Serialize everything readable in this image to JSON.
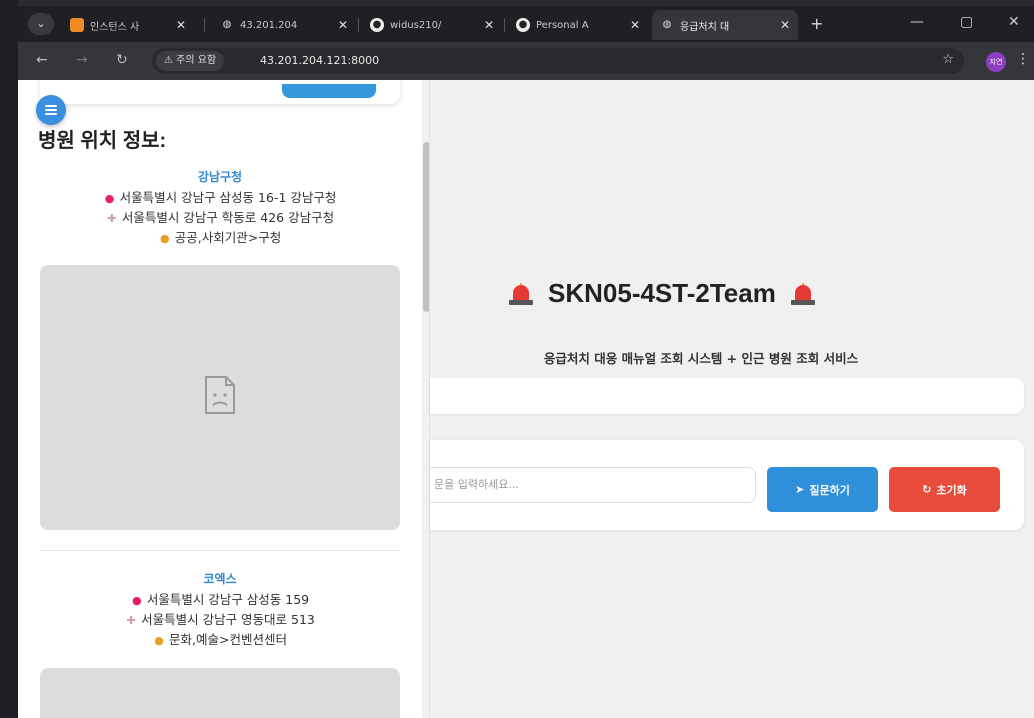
{
  "browser": {
    "tabs": [
      {
        "title": "인스턴스 사",
        "icon": "aws-icon",
        "active": false
      },
      {
        "title": "43.201.204",
        "icon": "globe-icon",
        "active": false
      },
      {
        "title": "widus210/",
        "icon": "github-icon",
        "active": false
      },
      {
        "title": "Personal A",
        "icon": "github-icon",
        "active": false
      },
      {
        "title": "응급처치 대",
        "icon": "globe-icon",
        "active": true
      }
    ],
    "new_tab": "+",
    "minimize": "—",
    "maximize": "▢",
    "close": "✕",
    "security_warning": "⚠ 주의 요함",
    "url": "43.201.204.121:8000",
    "profile_initials": "지연"
  },
  "sidebar": {
    "heading": "병원 위치 정보:",
    "places": [
      {
        "name": "강남구청",
        "address": "서울특별시 강남구 삼성동 16-1 강남구청",
        "road_address": "서울특별시 강남구 학동로 426 강남구청",
        "category": "공공,사회기관>구청"
      },
      {
        "name": "코엑스",
        "address": "서울특별시 강남구 삼성동 159",
        "road_address": "서울특별시 강남구 영동대로 513",
        "category": "문화,예술>컨벤션센터"
      }
    ]
  },
  "main": {
    "title": "SKN05-4ST-2Team",
    "subtitle": "응급처치 대응 매뉴얼 조회 시스템 + 인근 병원 조회 서비스",
    "input_placeholder": "문을 입력하세요...",
    "ask_button": "질문하기",
    "reset_button": "초기화"
  },
  "colors": {
    "accent_blue": "#2f8fd8",
    "reset_red": "#e74c3c",
    "place_name_blue": "#2f8ad6"
  }
}
